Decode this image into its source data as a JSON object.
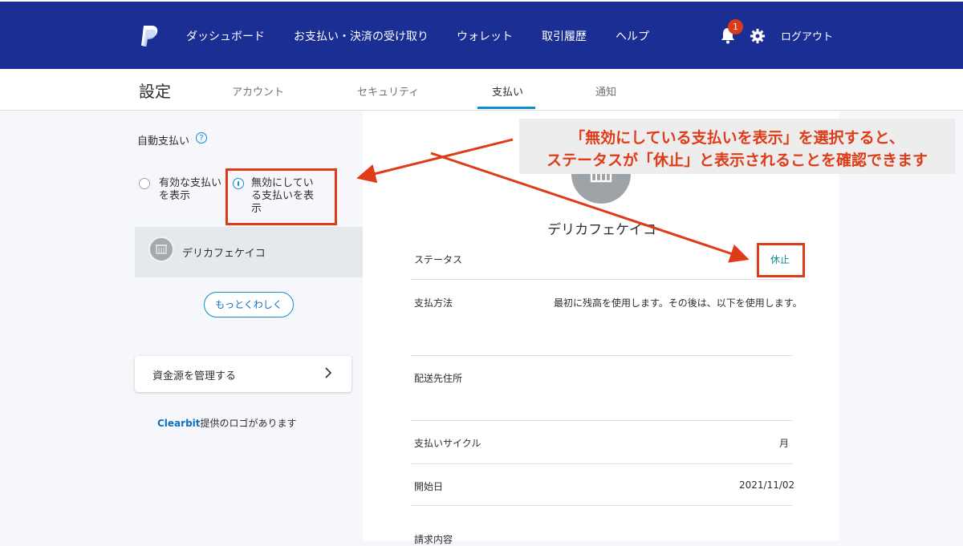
{
  "header": {
    "nav": [
      "ダッシュボード",
      "お支払い・決済の受け取り",
      "ウォレット",
      "取引履歴",
      "ヘルプ"
    ],
    "notification_count": "1",
    "logout_label": "ログアウト",
    "brand_color": "#1a2e93"
  },
  "settings": {
    "title": "設定",
    "tabs": [
      "アカウント",
      "セキュリティ",
      "支払い",
      "通知"
    ],
    "active_tab": "支払い"
  },
  "left_panel": {
    "heading": "自動支払い",
    "help_icon": "?",
    "radio_active": "有効な支払いを表示",
    "radio_active_lines": [
      "有効な支払い",
      "を表示"
    ],
    "radio_inactive": "無効にしている支払いを表示",
    "radio_inactive_lines": [
      "無効にしてい",
      "る支払いを表",
      "示"
    ],
    "selected": "inactive",
    "merchant_name": "デリカフェケイコ",
    "more_button": "もっとくわしく",
    "manage_funding": "資金源を管理する",
    "clearbit_link": "Clearbit",
    "clearbit_text": "提供のロゴがあります"
  },
  "detail": {
    "merchant_name": "デリカフェケイコ",
    "rows": [
      {
        "label": "ステータス",
        "value": "休止"
      },
      {
        "label": "支払方法",
        "value": "最初に残高を使用します。その後は、以下を使用します。"
      },
      {
        "label": "配送先住所",
        "value": ""
      },
      {
        "label": "支払いサイクル",
        "value": "月"
      },
      {
        "label": "開始日",
        "value": "2021/11/02"
      },
      {
        "label": "請求内容",
        "value": ""
      }
    ],
    "status_color": "#1a8a8a"
  },
  "annotation": {
    "line1": "「無効にしている支払いを表示」を選択すると、",
    "line2": "ステータスが「休止」と表示されることを確認できます",
    "color": "#e03b17"
  }
}
